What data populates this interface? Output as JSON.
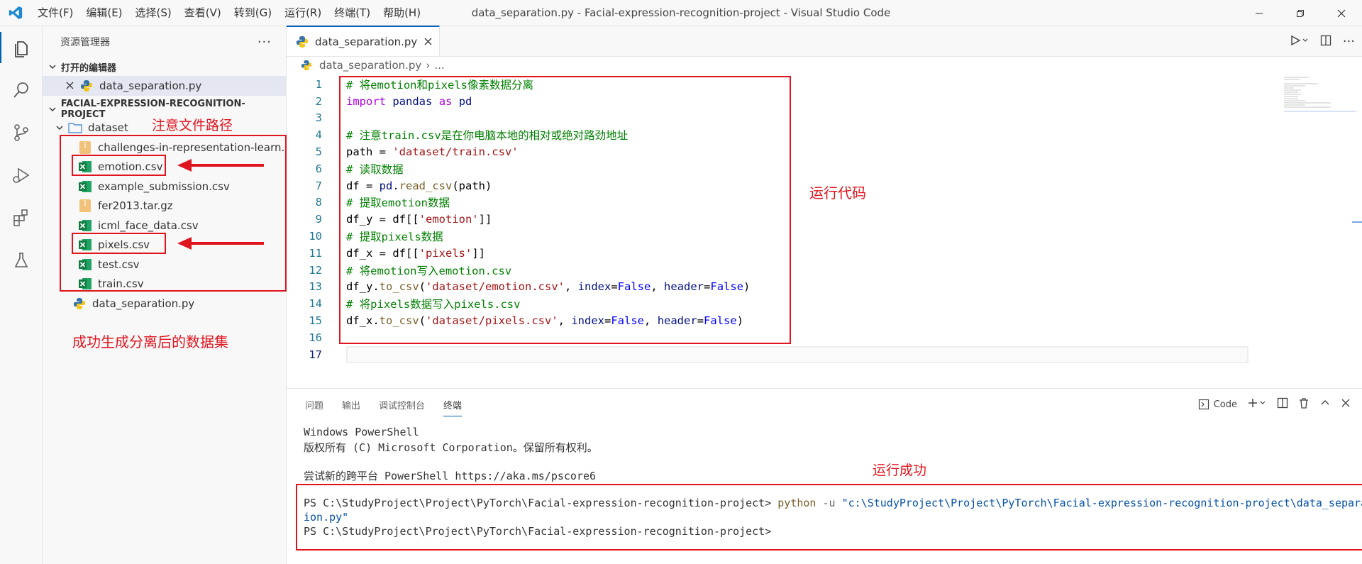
{
  "window": {
    "title": "data_separation.py - Facial-expression-recognition-project - Visual Studio Code",
    "menu": [
      "文件(F)",
      "编辑(E)",
      "选择(S)",
      "查看(V)",
      "转到(G)",
      "运行(R)",
      "终端(T)",
      "帮助(H)"
    ]
  },
  "sidebar": {
    "title": "资源管理器",
    "more": "···",
    "open_editors_label": "打开的编辑器",
    "open_editor_file": "data_separation.py",
    "project_label": "FACIAL-EXPRESSION-RECOGNITION-PROJECT",
    "folder_name": "dataset",
    "files": [
      {
        "name": "challenges-in-representation-learn...",
        "icon": "archive-icon"
      },
      {
        "name": "emotion.csv",
        "icon": "excel-icon"
      },
      {
        "name": "example_submission.csv",
        "icon": "excel-icon"
      },
      {
        "name": "fer2013.tar.gz",
        "icon": "archive-icon"
      },
      {
        "name": "icml_face_data.csv",
        "icon": "excel-icon"
      },
      {
        "name": "pixels.csv",
        "icon": "excel-icon"
      },
      {
        "name": "test.csv",
        "icon": "excel-icon"
      },
      {
        "name": "train.csv",
        "icon": "excel-icon"
      }
    ],
    "root_file": "data_separation.py"
  },
  "annotations": {
    "path_note": "注意文件路径",
    "run_code": "运行代码",
    "generated": "成功生成分离后的数据集",
    "run_success": "运行成功"
  },
  "editor": {
    "tab_label": "data_separation.py",
    "breadcrumb_file": "data_separation.py",
    "breadcrumb_more": "...",
    "line_numbers": [
      "1",
      "2",
      "3",
      "4",
      "5",
      "6",
      "7",
      "8",
      "9",
      "10",
      "11",
      "12",
      "13",
      "14",
      "15",
      "16",
      "17"
    ],
    "lines": [
      "# 将emotion和pixels像素数据分离",
      "import pandas as pd",
      "",
      "# 注意train.csv是在你电脑本地的相对或绝对路劲地址",
      "path = 'dataset/train.csv'",
      "# 读取数据",
      "df = pd.read_csv(path)",
      "# 提取emotion数据",
      "df_y = df[['emotion']]",
      "# 提取pixels数据",
      "df_x = df[['pixels']]",
      "# 将emotion写入emotion.csv",
      "df_y.to_csv('dataset/emotion.csv', index=False, header=False)",
      "# 将pixels数据写入pixels.csv",
      "df_x.to_csv('dataset/pixels.csv', index=False, header=False)",
      "",
      ""
    ]
  },
  "panel": {
    "tabs": [
      "问题",
      "输出",
      "调试控制台",
      "终端"
    ],
    "active_tab": "终端",
    "shell_label": "Code",
    "terminal": {
      "line1": "Windows PowerShell",
      "line2": "版权所有 (C) Microsoft Corporation。保留所有权利。",
      "line3": "尝试新的跨平台 PowerShell https://aka.ms/pscore6",
      "prompt": "PS C:\\StudyProject\\Project\\PyTorch\\Facial-expression-recognition-project> ",
      "cmd": "python",
      "flag": " -u ",
      "arg1": "\"c:\\StudyProject\\Project\\PyTorch\\Facial-expression-recognition-project\\data_separat",
      "arg2": "ion.py\"",
      "prompt2": "PS C:\\StudyProject\\Project\\PyTorch\\Facial-expression-recognition-project>"
    }
  }
}
